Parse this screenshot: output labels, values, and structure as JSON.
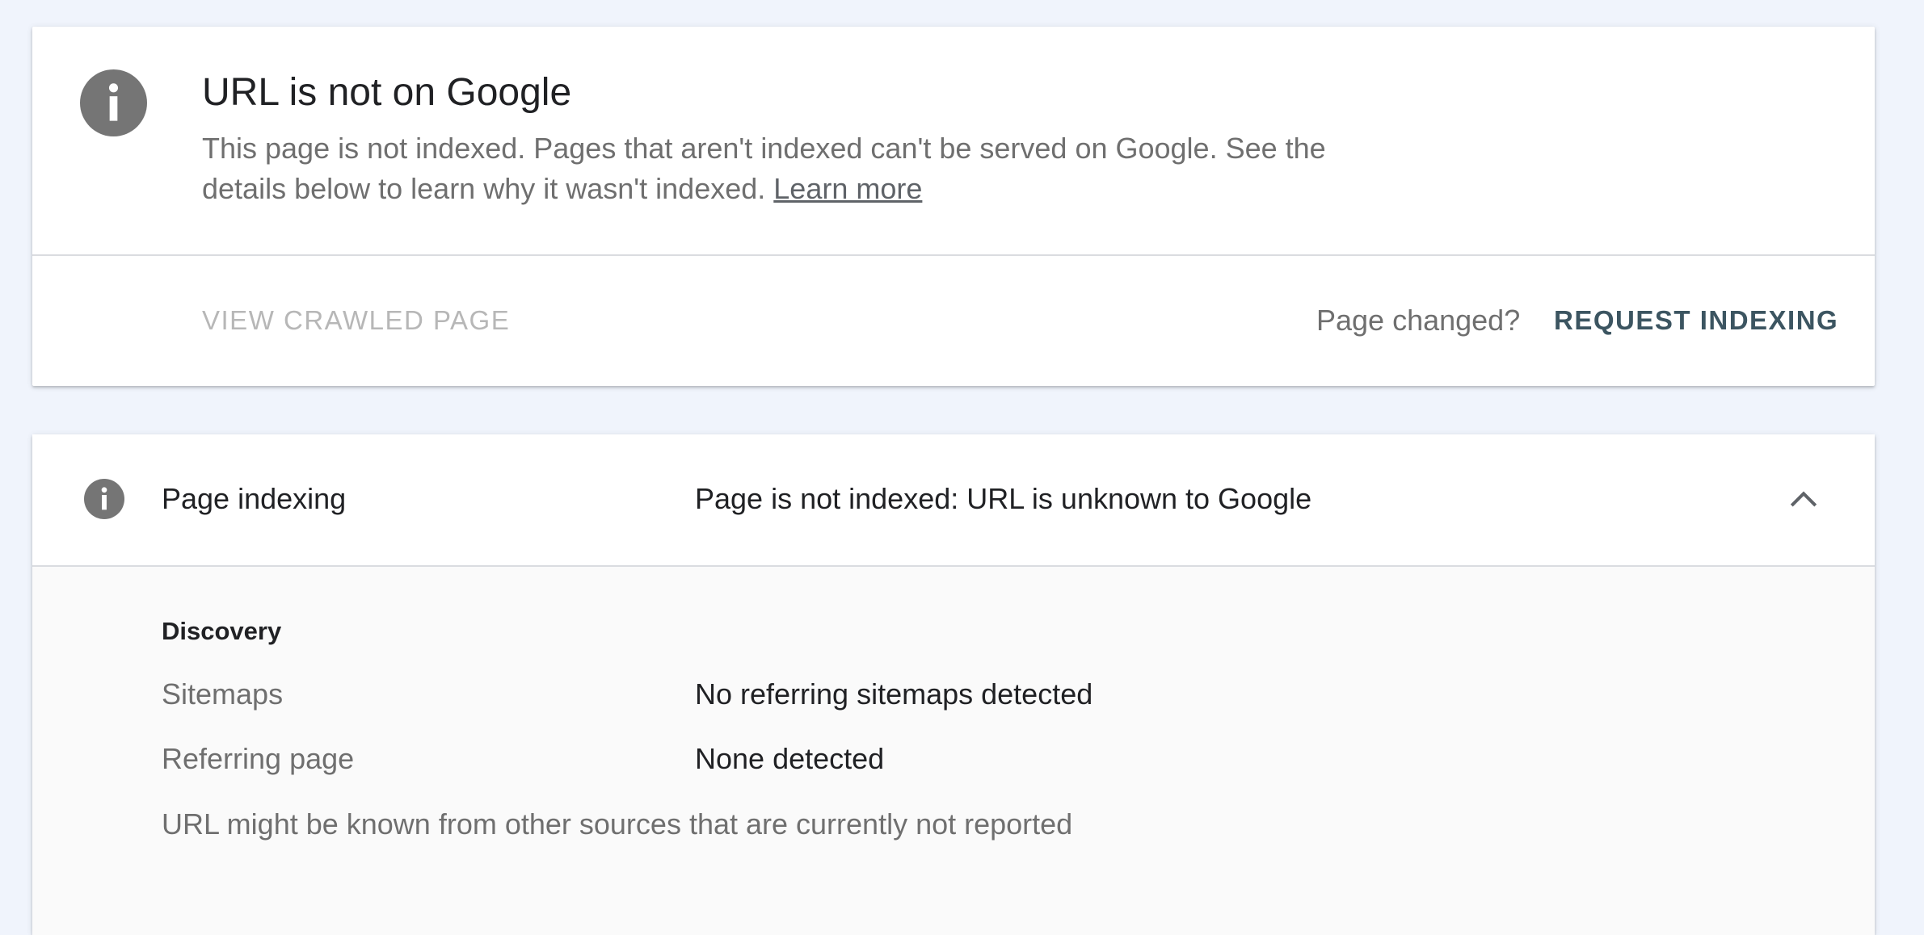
{
  "colors": {
    "page_background": "#f0f4fc",
    "card_background": "#ffffff",
    "icon_gray": "#757575",
    "primary_action": "#3c5561",
    "disabled_action": "#b7b7b7",
    "secondary_text": "#6f6f6f"
  },
  "summary": {
    "icon": "info-icon",
    "title": "URL is not on Google",
    "description": "This page is not indexed. Pages that aren't indexed can't be served on Google. See the details below to learn why it wasn't indexed.",
    "learn_more": "Learn more",
    "view_crawled_page": "VIEW CRAWLED PAGE",
    "page_changed": "Page changed?",
    "request_indexing": "REQUEST INDEXING"
  },
  "page_indexing": {
    "icon": "info-icon",
    "title": "Page indexing",
    "status": "Page is not indexed: URL is unknown to Google",
    "toggle_icon": "chevron-up-icon",
    "discovery": {
      "heading": "Discovery",
      "rows": [
        {
          "label": "Sitemaps",
          "value": "No referring sitemaps detected"
        },
        {
          "label": "Referring page",
          "value": "None detected"
        }
      ],
      "note": "URL might be known from other sources that are currently not reported"
    }
  }
}
